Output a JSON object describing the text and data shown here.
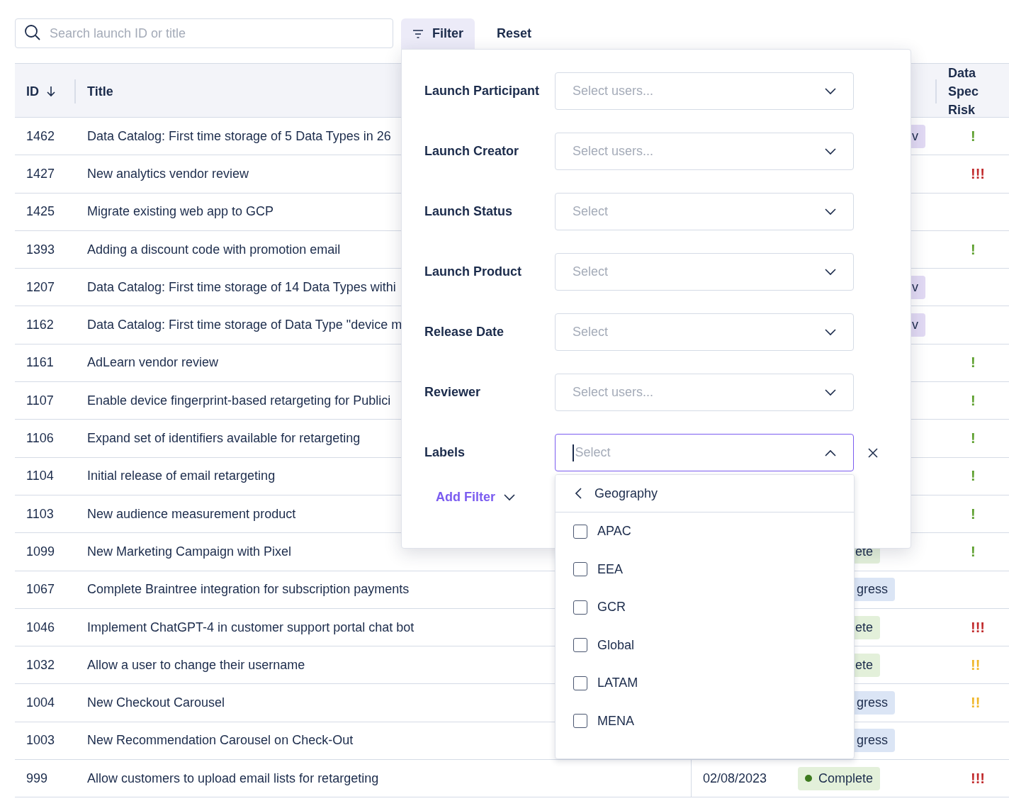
{
  "search": {
    "placeholder": "Search launch ID or title"
  },
  "toolbar": {
    "filter_button": {
      "label": "Filter",
      "selected": true
    },
    "reset_button": {
      "label": "Reset"
    }
  },
  "table": {
    "columns": [
      {
        "kind": "id",
        "label": "ID"
      },
      {
        "kind": "title",
        "label": "Title"
      },
      {
        "kind": "risk",
        "label": "Data Spec Risk"
      }
    ],
    "rows": [
      {
        "id": "1462",
        "title": "Data Catalog: First time storage of 5 Data Types in 26",
        "status": {
          "kind": "review",
          "text": "v"
        },
        "risk": {
          "kind": "low",
          "text": "!"
        }
      },
      {
        "id": "1427",
        "title": "New analytics vendor review",
        "risk": {
          "kind": "high",
          "text": "!!!"
        }
      },
      {
        "id": "1425",
        "title": "Migrate existing web app to GCP"
      },
      {
        "id": "1393",
        "title": "Adding a discount code with promotion email",
        "risk": {
          "kind": "low",
          "text": "!"
        }
      },
      {
        "id": "1207",
        "title": "Data Catalog: First time storage of 14 Data Types withi",
        "status": {
          "kind": "review",
          "text": "v"
        }
      },
      {
        "id": "1162",
        "title": "Data Catalog: First time storage of Data Type \"device m",
        "status": {
          "kind": "review",
          "text": "v"
        }
      },
      {
        "id": "1161",
        "title": "AdLearn vendor review",
        "risk": {
          "kind": "low",
          "text": "!"
        }
      },
      {
        "id": "1107",
        "title": "Enable device fingerprint-based retargeting for Publici",
        "risk": {
          "kind": "low",
          "text": "!"
        }
      },
      {
        "id": "1106",
        "title": "Expand set of identifiers available for retargeting",
        "risk": {
          "kind": "low",
          "text": "!"
        }
      },
      {
        "id": "1104",
        "title": "Initial release of email retargeting",
        "risk": {
          "kind": "low",
          "text": "!"
        }
      },
      {
        "id": "1103",
        "title": "New audience measurement product",
        "risk": {
          "kind": "low",
          "text": "!"
        }
      },
      {
        "id": "1099",
        "title": "New Marketing Campaign with Pixel",
        "status": {
          "kind": "complete",
          "text": "ete"
        },
        "risk": {
          "kind": "low",
          "text": "!"
        }
      },
      {
        "id": "1067",
        "title": "Complete Braintree integration for subscription payments",
        "status": {
          "kind": "progress",
          "text": "gress"
        }
      },
      {
        "id": "1046",
        "title": "Implement ChatGPT-4 in customer support portal chat bot",
        "status": {
          "kind": "complete",
          "text": "ete"
        },
        "risk": {
          "kind": "high",
          "text": "!!!"
        }
      },
      {
        "id": "1032",
        "title": "Allow a user to change their username",
        "status": {
          "kind": "complete",
          "text": "ete"
        },
        "risk": {
          "kind": "medium",
          "text": "!!"
        }
      },
      {
        "id": "1004",
        "title": "New Checkout Carousel",
        "status": {
          "kind": "progress",
          "text": "gress"
        },
        "risk": {
          "kind": "medium",
          "text": "!!"
        }
      },
      {
        "id": "1003",
        "title": "New Recommendation Carousel on Check-Out",
        "status": {
          "kind": "progress",
          "text": "gress"
        }
      },
      {
        "id": "999",
        "title": "Allow customers to upload email lists for retargeting",
        "date": "02/08/2023",
        "status": {
          "kind": "complete",
          "text": "Complete",
          "dot": true
        },
        "risk": {
          "kind": "high",
          "text": "!!!"
        }
      }
    ]
  },
  "filter_panel": {
    "fields": [
      {
        "label": "Launch Participant",
        "placeholder": "Select users...",
        "open": false
      },
      {
        "label": "Launch Creator",
        "placeholder": "Select users...",
        "open": false
      },
      {
        "label": "Launch Status",
        "placeholder": "Select",
        "open": false
      },
      {
        "label": "Launch Product",
        "placeholder": "Select",
        "open": false
      },
      {
        "label": "Release Date",
        "placeholder": "Select",
        "open": false
      },
      {
        "label": "Reviewer",
        "placeholder": "Select users...",
        "open": false
      },
      {
        "label": "Labels",
        "placeholder": "Select",
        "open": true
      }
    ],
    "add_filter": "Add Filter",
    "dropdown": {
      "group": "Geography",
      "options": [
        {
          "label": "APAC",
          "checked": false
        },
        {
          "label": "EEA",
          "checked": false
        },
        {
          "label": "GCR",
          "checked": false
        },
        {
          "label": "Global",
          "checked": false
        },
        {
          "label": "LATAM",
          "checked": false
        },
        {
          "label": "MENA",
          "checked": false
        }
      ]
    }
  }
}
